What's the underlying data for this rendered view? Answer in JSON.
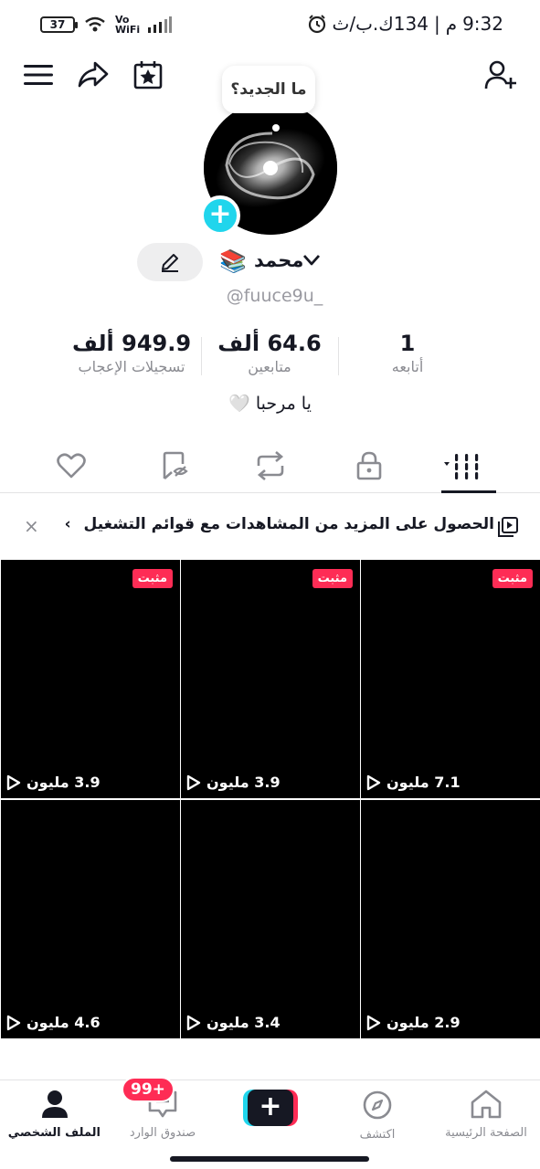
{
  "status_bar": {
    "battery": "37",
    "network": "Vo WiFi",
    "time": "9:32",
    "meridiem": "م",
    "center_text": "134ك.ب/ث"
  },
  "profile": {
    "whats_new": "ما الجديد؟",
    "name": "محمد",
    "name_emoji": "📚",
    "handle": "@fuuce9u_",
    "bio": "يا مرحبا 🤍"
  },
  "stats": [
    {
      "value": "1",
      "label": "أتابعه"
    },
    {
      "value": "64.6 ألف",
      "label": "متابعين"
    },
    {
      "value": "949.9 ألف",
      "label": "تسجيلات الإعجاب"
    }
  ],
  "banner": {
    "text": "الحصول على المزيد من المشاهدات مع قوائم التشغيل",
    "chevron": "›",
    "close": "×"
  },
  "videos": [
    {
      "views": "7.1 مليون",
      "pinned": "مثبت"
    },
    {
      "views": "3.9 مليون",
      "pinned": "مثبت"
    },
    {
      "views": "3.9 مليون",
      "pinned": "مثبت"
    },
    {
      "views": "2.9 مليون",
      "pinned": ""
    },
    {
      "views": "3.4 مليون",
      "pinned": ""
    },
    {
      "views": "4.6 مليون",
      "pinned": ""
    }
  ],
  "bottom_nav": {
    "home": "الصفحة الرئيسية",
    "discover": "اكتشف",
    "create": "+",
    "inbox": "صندوق الوارد",
    "inbox_badge": "99+",
    "profile": "الملف الشخصي"
  },
  "colors": {
    "accent": "#fe2c55",
    "cyan": "#20d5ec",
    "text": "#161823",
    "muted": "#8a8b91"
  }
}
